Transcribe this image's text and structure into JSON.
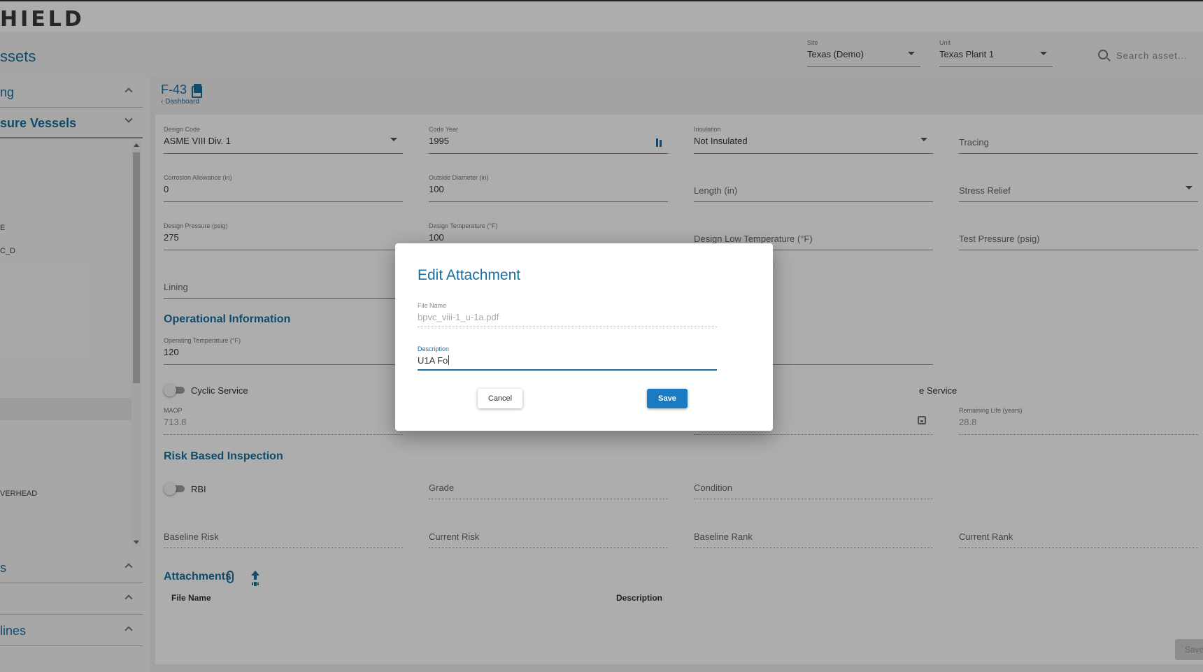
{
  "app": {
    "logo_text": "HIELD"
  },
  "header": {
    "page_title": "ssets",
    "site": {
      "label": "Site",
      "value": "Texas (Demo)"
    },
    "unit": {
      "label": "Unit",
      "value": "Texas Plant 1"
    },
    "search": {
      "placeholder": "Search asset..."
    }
  },
  "sidebar": {
    "sections": [
      {
        "title": "ng",
        "expanded": false
      },
      {
        "title": "sure Vessels",
        "expanded": true
      },
      {
        "title": "s",
        "expanded": false
      },
      {
        "title": "",
        "expanded": false
      },
      {
        "title": "lines",
        "expanded": false
      }
    ],
    "items": [
      "E",
      "C_D",
      "VERHEAD"
    ]
  },
  "asset": {
    "id": "F-43",
    "breadcrumb": "Dashboard"
  },
  "design": {
    "design_code": {
      "label": "Design Code",
      "value": "ASME VIII Div. 1"
    },
    "code_year": {
      "label": "Code Year",
      "value": "1995"
    },
    "insulation": {
      "label": "Insulation",
      "value": "Not Insulated"
    },
    "tracing": {
      "placeholder": "Tracing"
    },
    "corrosion_allowance": {
      "label": "Corrosion Allowance (in)",
      "value": "0"
    },
    "outside_diameter": {
      "label": "Outside Diameter (in)",
      "value": "100"
    },
    "length": {
      "placeholder": "Length (in)"
    },
    "stress_relief": {
      "placeholder": "Stress Relief"
    },
    "design_pressure": {
      "label": "Design Pressure (psig)",
      "value": "275"
    },
    "design_temperature": {
      "label": "Design Temperature (°F)",
      "value": "100"
    },
    "design_low_temperature": {
      "placeholder": "Design Low Temperature (°F)"
    },
    "test_pressure": {
      "placeholder": "Test Pressure (psig)"
    },
    "lining": {
      "placeholder": "Lining"
    }
  },
  "operational": {
    "title": "Operational Information",
    "operating_temperature": {
      "label": "Operating Temperature (°F)",
      "value": "120"
    },
    "cyclic_service": "Cyclic Service",
    "other_service_suffix": "e Service",
    "maop": {
      "label": "MAOP",
      "value": "713.8"
    },
    "remaining_life": {
      "label": "Remaining Life (years)",
      "value": "28.8"
    }
  },
  "rbi": {
    "title": "Risk Based Inspection",
    "toggle_label": "RBI",
    "grade": "Grade",
    "condition": "Condition",
    "baseline_risk": "Baseline Risk",
    "current_risk": "Current Risk",
    "baseline_rank": "Baseline Rank",
    "current_rank": "Current Rank"
  },
  "attachments": {
    "title": "Attachments",
    "col_file_name": "File Name",
    "col_description": "Description"
  },
  "footer": {
    "save_label": "Save"
  },
  "dialog": {
    "title": "Edit Attachment",
    "file_name": {
      "label": "File Name",
      "value": "bpvc_viii-1_u-1a.pdf"
    },
    "description": {
      "label": "Description",
      "value": "U1A Fo"
    },
    "cancel_label": "Cancel",
    "save_label": "Save"
  },
  "colors": {
    "accent": "#1a6fa0",
    "primary_button": "#1a7bc0"
  }
}
